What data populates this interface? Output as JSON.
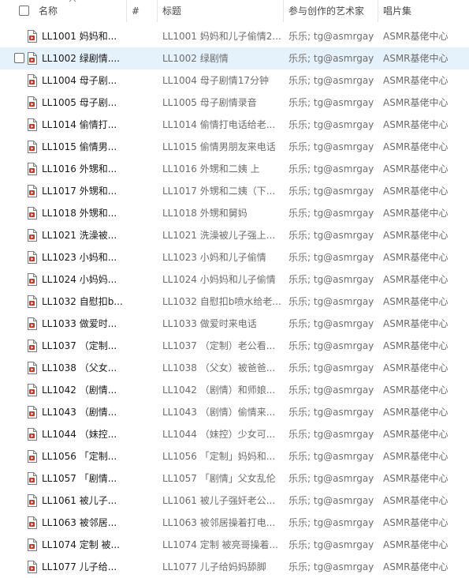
{
  "columns": {
    "name": "名称",
    "number": "#",
    "title": "标题",
    "artists": "参与创作的艺术家",
    "album": "唱片集"
  },
  "icons": {
    "file": "audio-file-icon",
    "sort": "sort-ascending-icon"
  },
  "colors": {
    "selection": "#e5f1fb",
    "file_icon_accent": "#c0392b"
  },
  "rows": [
    {
      "name": "LL1001 妈妈和...",
      "title": "LL1001 妈妈和儿子偷情2...",
      "artist": "乐乐; tg@asmrgay",
      "album": "ASMR基佬中心"
    },
    {
      "name": "LL1002 绿剧情....",
      "title": "LL1002 绿剧情",
      "artist": "乐乐; tg@asmrgay",
      "album": "ASMR基佬中心",
      "selected": true
    },
    {
      "name": "LL1004 母子剧...",
      "title": "LL1004 母子剧情17分钟",
      "artist": "乐乐; tg@asmrgay",
      "album": "ASMR基佬中心"
    },
    {
      "name": "LL1005 母子剧...",
      "title": "LL1005 母子剧情录音",
      "artist": "乐乐; tg@asmrgay",
      "album": "ASMR基佬中心"
    },
    {
      "name": "LL1014 偷情打...",
      "title": "LL1014 偷情打电话给老...",
      "artist": "乐乐; tg@asmrgay",
      "album": "ASMR基佬中心"
    },
    {
      "name": "LL1015 偷情男...",
      "title": "LL1015 偷情男朋友来电话",
      "artist": "乐乐; tg@asmrgay",
      "album": "ASMR基佬中心"
    },
    {
      "name": "LL1016 外甥和...",
      "title": "LL1016 外甥和二姨 上",
      "artist": "乐乐; tg@asmrgay",
      "album": "ASMR基佬中心"
    },
    {
      "name": "LL1017 外甥和...",
      "title": "LL1017 外甥和二姨（下...",
      "artist": "乐乐; tg@asmrgay",
      "album": "ASMR基佬中心"
    },
    {
      "name": "LL1018 外甥和...",
      "title": "LL1018 外甥和舅妈",
      "artist": "乐乐; tg@asmrgay",
      "album": "ASMR基佬中心"
    },
    {
      "name": "LL1021 洗澡被...",
      "title": "LL1021 洗澡被儿子强上...",
      "artist": "乐乐; tg@asmrgay",
      "album": "ASMR基佬中心"
    },
    {
      "name": "LL1023 小妈和...",
      "title": "LL1023 小妈和儿子偷情",
      "artist": "乐乐; tg@asmrgay",
      "album": "ASMR基佬中心"
    },
    {
      "name": "LL1024 小妈妈...",
      "title": "LL1024 小妈妈和儿子偷情",
      "artist": "乐乐; tg@asmrgay",
      "album": "ASMR基佬中心"
    },
    {
      "name": "LL1032 自慰扣b...",
      "title": "LL1032 自慰扣b喷水给老...",
      "artist": "乐乐; tg@asmrgay",
      "album": "ASMR基佬中心"
    },
    {
      "name": "LL1033 做爱时...",
      "title": "LL1033 做爱时来电话",
      "artist": "乐乐; tg@asmrgay",
      "album": "ASMR基佬中心"
    },
    {
      "name": "LL1037 （定制...",
      "title": "LL1037 （定制）老公看...",
      "artist": "乐乐; tg@asmrgay",
      "album": "ASMR基佬中心"
    },
    {
      "name": "LL1038 （父女...",
      "title": "LL1038 （父女）被爸爸...",
      "artist": "乐乐; tg@asmrgay",
      "album": "ASMR基佬中心"
    },
    {
      "name": "LL1042 （剧情...",
      "title": "LL1042 （剧情）和师娘...",
      "artist": "乐乐; tg@asmrgay",
      "album": "ASMR基佬中心"
    },
    {
      "name": "LL1043 （剧情...",
      "title": "LL1043 （剧情）偷情来...",
      "artist": "乐乐; tg@asmrgay",
      "album": "ASMR基佬中心"
    },
    {
      "name": "LL1044 （妹控...",
      "title": "LL1044 （妹控）少女可...",
      "artist": "乐乐; tg@asmrgay",
      "album": "ASMR基佬中心"
    },
    {
      "name": "LL1056 「定制...",
      "title": "LL1056 「定制」妈妈和...",
      "artist": "乐乐; tg@asmrgay",
      "album": "ASMR基佬中心"
    },
    {
      "name": "LL1057 「剧情...",
      "title": "LL1057 「剧情」父女乱伦",
      "artist": "乐乐; tg@asmrgay",
      "album": "ASMR基佬中心"
    },
    {
      "name": "LL1061 被儿子...",
      "title": "LL1061 被儿子强奸老公...",
      "artist": "乐乐; tg@asmrgay",
      "album": "ASMR基佬中心"
    },
    {
      "name": "LL1063 被邻居...",
      "title": "LL1063 被邻居操着打电...",
      "artist": "乐乐; tg@asmrgay",
      "album": "ASMR基佬中心"
    },
    {
      "name": "LL1074 定制 被...",
      "title": "LL1074 定制 被亮哥操着...",
      "artist": "乐乐; tg@asmrgay",
      "album": "ASMR基佬中心"
    },
    {
      "name": "LL1077 儿子给...",
      "title": "LL1077 儿子给妈妈舔脚",
      "artist": "乐乐; tg@asmrgay",
      "album": "ASMR基佬中心"
    }
  ]
}
